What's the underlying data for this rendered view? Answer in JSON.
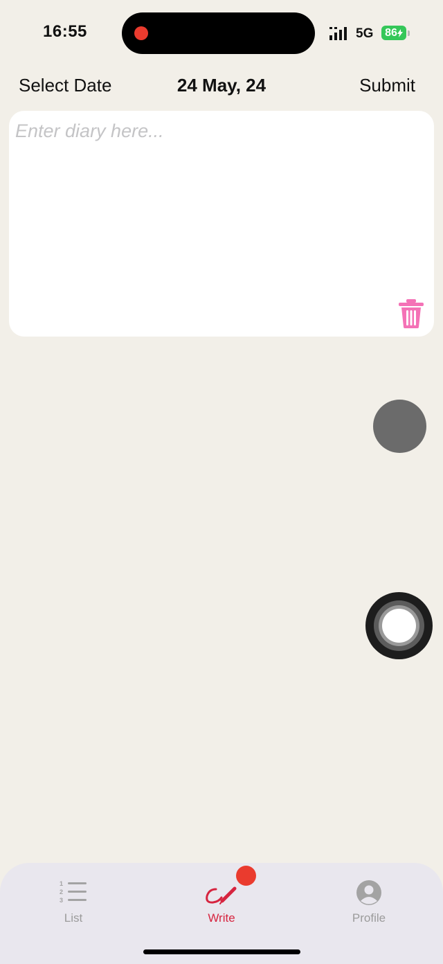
{
  "status_bar": {
    "time": "16:55",
    "network": "5G",
    "battery": "86",
    "battery_color": "#35c759",
    "recording_color": "#ea3b2e"
  },
  "header": {
    "select_date_label": "Select Date",
    "date": "24 May, 24",
    "submit_label": "Submit"
  },
  "diary": {
    "value": "",
    "placeholder": "Enter diary here...",
    "delete_icon": "trash-icon",
    "delete_color": "#f472b6"
  },
  "tabs": [
    {
      "label": "List",
      "icon": "numbered-list-icon",
      "active": false
    },
    {
      "label": "Write",
      "icon": "pen-signature-icon",
      "active": true
    },
    {
      "label": "Profile",
      "icon": "person-circle-icon",
      "active": false
    }
  ],
  "colors": {
    "background": "#f2efe8",
    "accent": "#d6243f",
    "tab_inactive": "#9b9b9b"
  }
}
